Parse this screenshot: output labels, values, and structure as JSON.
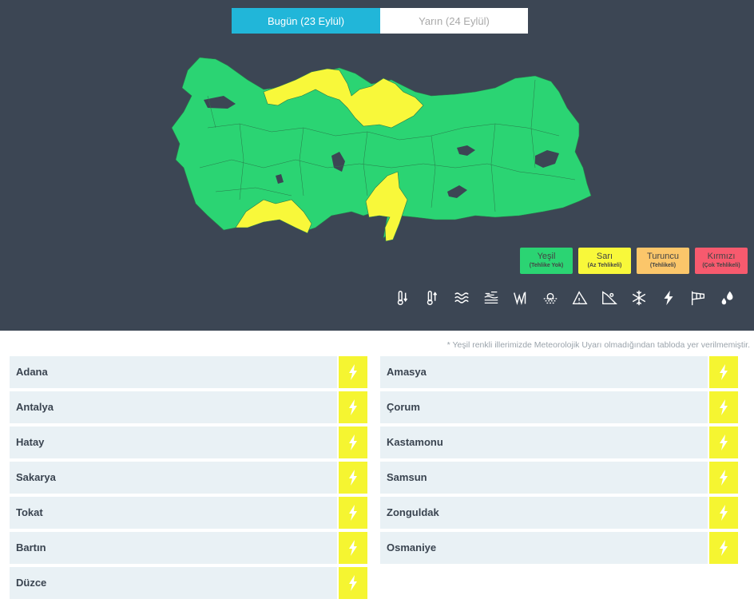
{
  "tabs": [
    {
      "label": "Bugün (23 Eylül)",
      "active": true
    },
    {
      "label": "Yarın (24 Eylül)",
      "active": false
    }
  ],
  "legend": [
    {
      "title": "Yeşil",
      "subtitle": "(Tehlike Yok)",
      "color": "#2bd473"
    },
    {
      "title": "Sarı",
      "subtitle": "(Az Tehlikeli)",
      "color": "#f8f83a"
    },
    {
      "title": "Turuncu",
      "subtitle": "(Tehlikeli)",
      "color": "#fbc66a"
    },
    {
      "title": "Kırmızı",
      "subtitle": "(Çok Tehlikeli)",
      "color": "#f75a6e"
    }
  ],
  "hazard_icons": [
    "cold-thermometer-icon",
    "hot-thermometer-icon",
    "waves-icon",
    "dust-icon",
    "wind-icon",
    "fog-icon",
    "avalanche-icon",
    "landslide-icon",
    "snowflake-icon",
    "thunderstorm-icon",
    "windsock-icon",
    "rain-drops-icon"
  ],
  "map": {
    "colors": {
      "green": "#2bd473",
      "yellow": "#f8f83a",
      "lake": "#3c4654"
    }
  },
  "note": "* Yeşil renkli illerimizde Meteorolojik Uyarı olmadığından tabloda yer verilmemiştir.",
  "left_list": [
    "Adana",
    "Antalya",
    "Hatay",
    "Sakarya",
    "Tokat",
    "Bartın",
    "Düzce"
  ],
  "right_list": [
    "Amasya",
    "Çorum",
    "Kastamonu",
    "Samsun",
    "Zonguldak",
    "Osmaniye"
  ],
  "warning_icon": "thunderstorm-icon",
  "warning_color": "#f5f531"
}
